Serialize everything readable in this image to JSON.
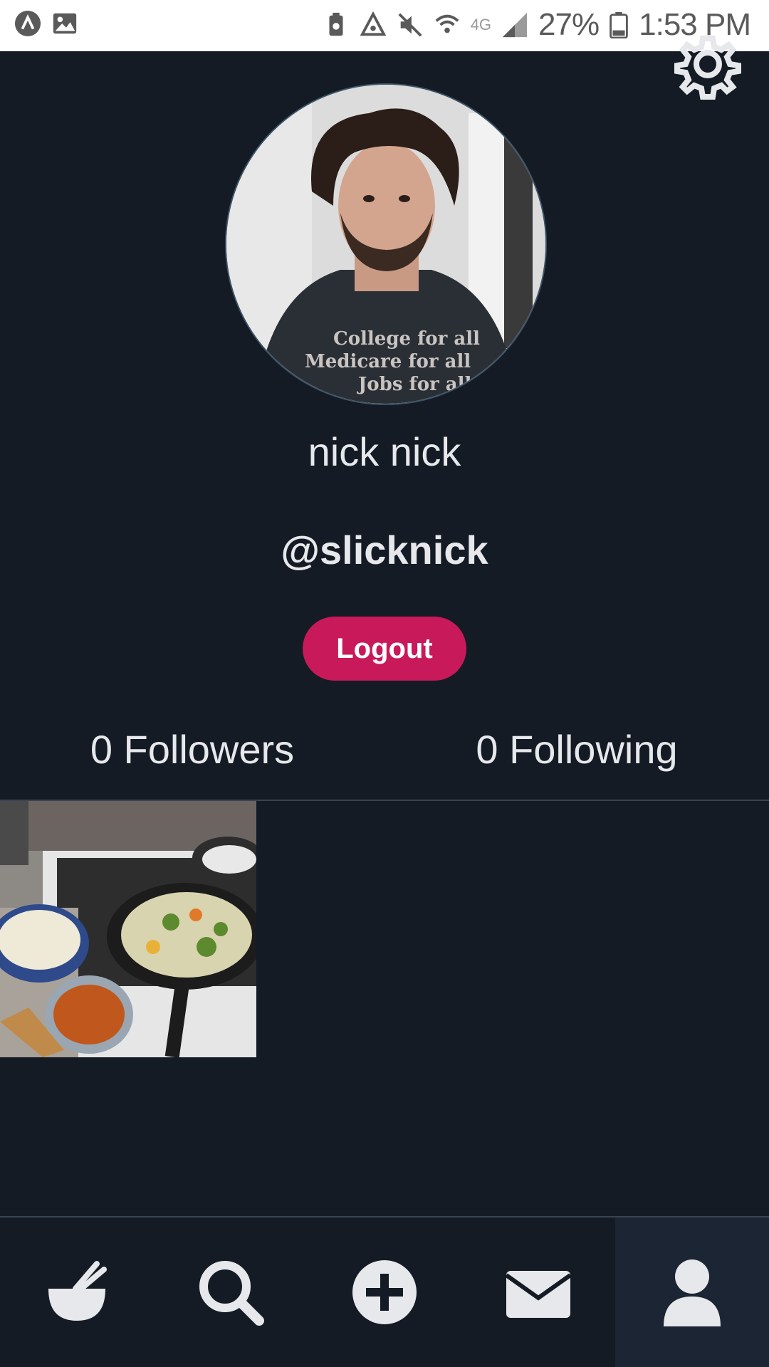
{
  "status_bar": {
    "battery": "27%",
    "time": "1:53 PM",
    "network": "4G"
  },
  "profile": {
    "display_name": "nick nick",
    "username": "@slicknick",
    "logout_label": "Logout",
    "followers": "0 Followers",
    "following": "0 Following"
  },
  "avatar_shirt_text": [
    "College for all",
    "Medicare for all",
    "Jobs for all"
  ],
  "posts": [
    {
      "alt": "Cooking on stove"
    }
  ],
  "nav": {
    "items": [
      {
        "icon": "bowl-icon",
        "active": false
      },
      {
        "icon": "search-icon",
        "active": false
      },
      {
        "icon": "add-icon",
        "active": false
      },
      {
        "icon": "mail-icon",
        "active": false
      },
      {
        "icon": "user-icon",
        "active": true
      }
    ]
  },
  "colors": {
    "background": "#141b24",
    "accent": "#c8195a",
    "text": "#e6e8eb"
  }
}
